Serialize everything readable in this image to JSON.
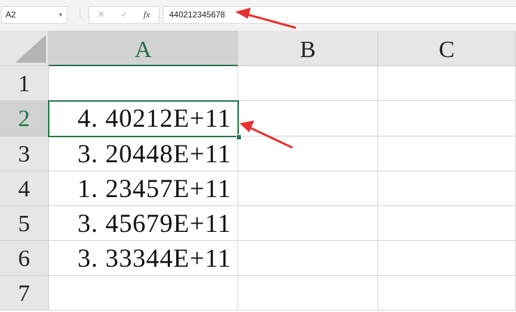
{
  "name_box": {
    "value": "A2"
  },
  "formula_bar": {
    "cancel_icon": "✕",
    "enter_icon": "✓",
    "fx_label": "fx",
    "value": "440212345678"
  },
  "columns": [
    "A",
    "B",
    "C"
  ],
  "rows": [
    {
      "num": "1",
      "a": ""
    },
    {
      "num": "2",
      "a": "4. 40212E+11"
    },
    {
      "num": "3",
      "a": "3. 20448E+11"
    },
    {
      "num": "4",
      "a": "1. 23457E+11"
    },
    {
      "num": "5",
      "a": "3. 45679E+11"
    },
    {
      "num": "6",
      "a": "3. 33344E+11"
    },
    {
      "num": "7",
      "a": ""
    }
  ],
  "colors": {
    "accent": "#217346",
    "arrow": "#e8302e"
  }
}
